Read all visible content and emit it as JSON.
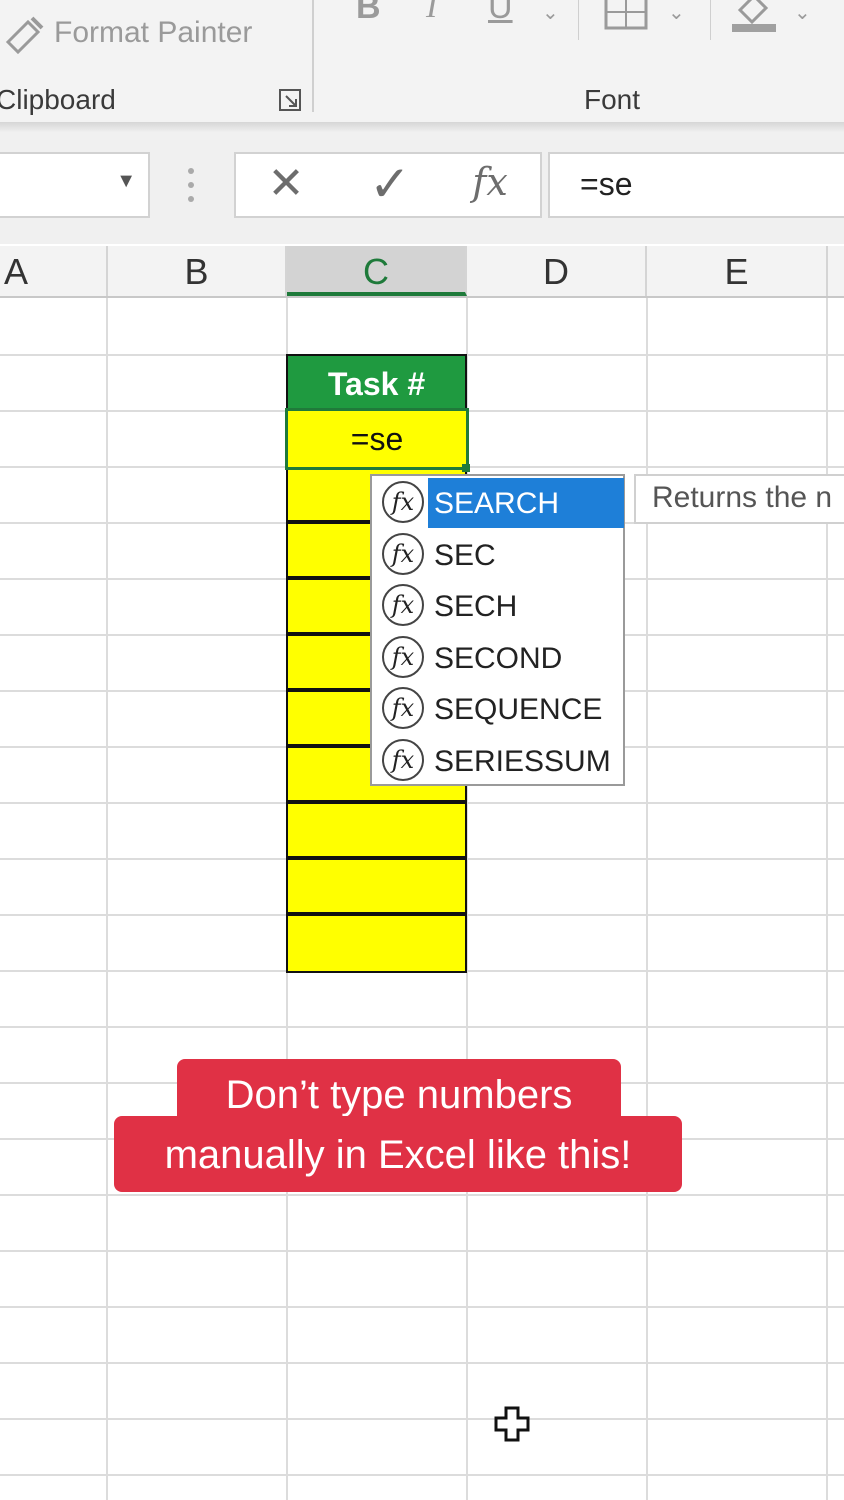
{
  "ribbon": {
    "format_painter_label": "Format Painter",
    "clipboard_label": "Clipboard",
    "font_label": "Font",
    "bold_label": "B",
    "italic_label": "I",
    "underline_label": "U"
  },
  "name_box": {
    "value": ""
  },
  "formula_bar": {
    "cancel_symbol": "✕",
    "enter_symbol": "✓",
    "fx_label": "fx",
    "value": "=se"
  },
  "columns": [
    "A",
    "B",
    "C",
    "D",
    "E"
  ],
  "selected_column": "C",
  "table": {
    "header": "Task #",
    "active_cell_value": "=se",
    "header_color": "#1f9a40",
    "fill_color": "#ffff00"
  },
  "autocomplete": {
    "items": [
      "SEARCH",
      "SEC",
      "SECH",
      "SECOND",
      "SEQUENCE",
      "SERIESSUM"
    ],
    "selected": "SEARCH",
    "tooltip": "Returns the n"
  },
  "caption": {
    "line1": "Don’t type numbers",
    "line2": "manually in Excel like this!",
    "color": "#e03145"
  }
}
